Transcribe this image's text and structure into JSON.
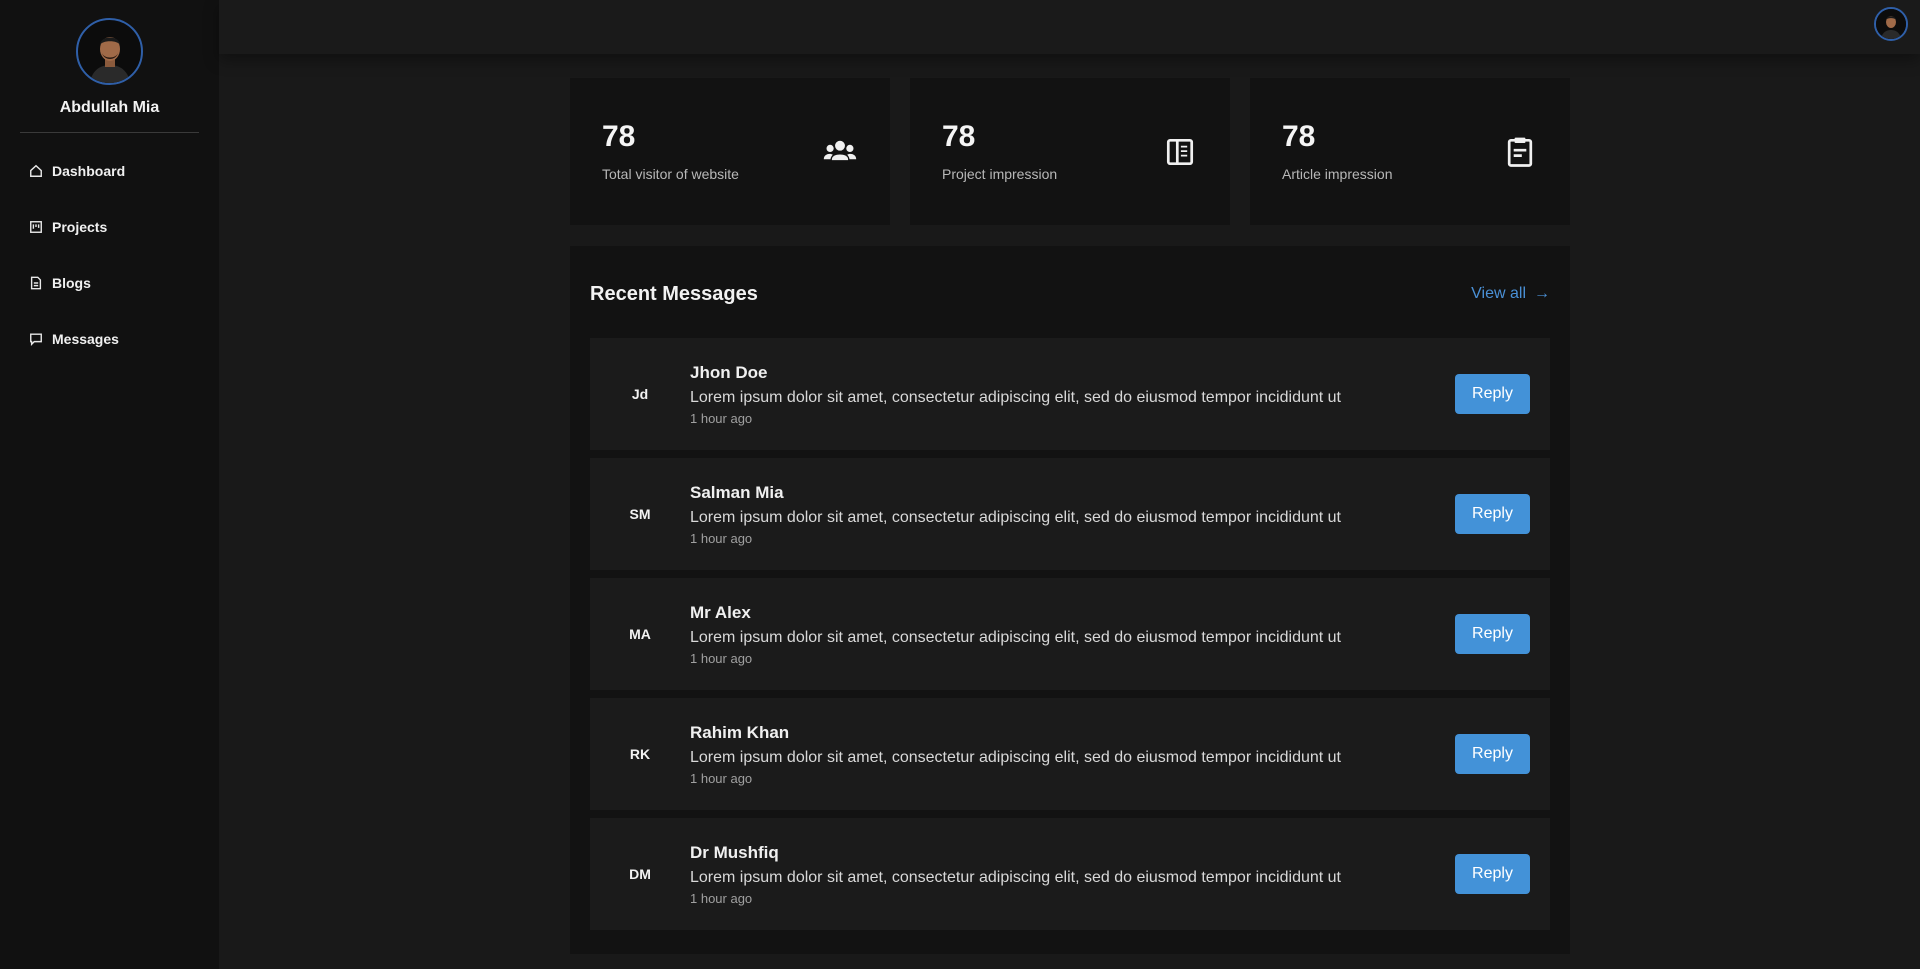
{
  "sidebar": {
    "profile_name": "Abdullah Mia",
    "nav": [
      {
        "label": "Dashboard",
        "icon": "home-icon"
      },
      {
        "label": "Projects",
        "icon": "projects-icon"
      },
      {
        "label": "Blogs",
        "icon": "document-icon"
      },
      {
        "label": "Messages",
        "icon": "chat-icon"
      }
    ]
  },
  "stats": [
    {
      "value": "78",
      "label": "Total visitor of website",
      "icon": "users-icon"
    },
    {
      "value": "78",
      "label": "Project impression",
      "icon": "layout-icon"
    },
    {
      "value": "78",
      "label": "Article impression",
      "icon": "clipboard-icon"
    }
  ],
  "messages_panel": {
    "title": "Recent Messages",
    "view_all": "View all",
    "view_all_arrow": "→",
    "items": [
      {
        "initials": "Jd",
        "name": "Jhon Doe",
        "text": "Lorem ipsum dolor sit amet, consectetur adipiscing elit, sed do eiusmod tempor incididunt ut",
        "time": "1 hour ago",
        "reply": "Reply"
      },
      {
        "initials": "SM",
        "name": "Salman Mia",
        "text": "Lorem ipsum dolor sit amet, consectetur adipiscing elit, sed do eiusmod tempor incididunt ut",
        "time": "1 hour ago",
        "reply": "Reply"
      },
      {
        "initials": "MA",
        "name": "Mr Alex",
        "text": "Lorem ipsum dolor sit amet, consectetur adipiscing elit, sed do eiusmod tempor incididunt ut",
        "time": "1 hour ago",
        "reply": "Reply"
      },
      {
        "initials": "RK",
        "name": "Rahim Khan",
        "text": "Lorem ipsum dolor sit amet, consectetur adipiscing elit, sed do eiusmod tempor incididunt ut",
        "time": "1 hour ago",
        "reply": "Reply"
      },
      {
        "initials": "DM",
        "name": "Dr Mushfiq",
        "text": "Lorem ipsum dolor sit amet, consectetur adipiscing elit, sed do eiusmod tempor incididunt ut",
        "time": "1 hour ago",
        "reply": "Reply"
      }
    ]
  },
  "colors": {
    "accent": "#4392d8",
    "link": "#4a90d6",
    "avatar_border": "#2f5fa8"
  }
}
